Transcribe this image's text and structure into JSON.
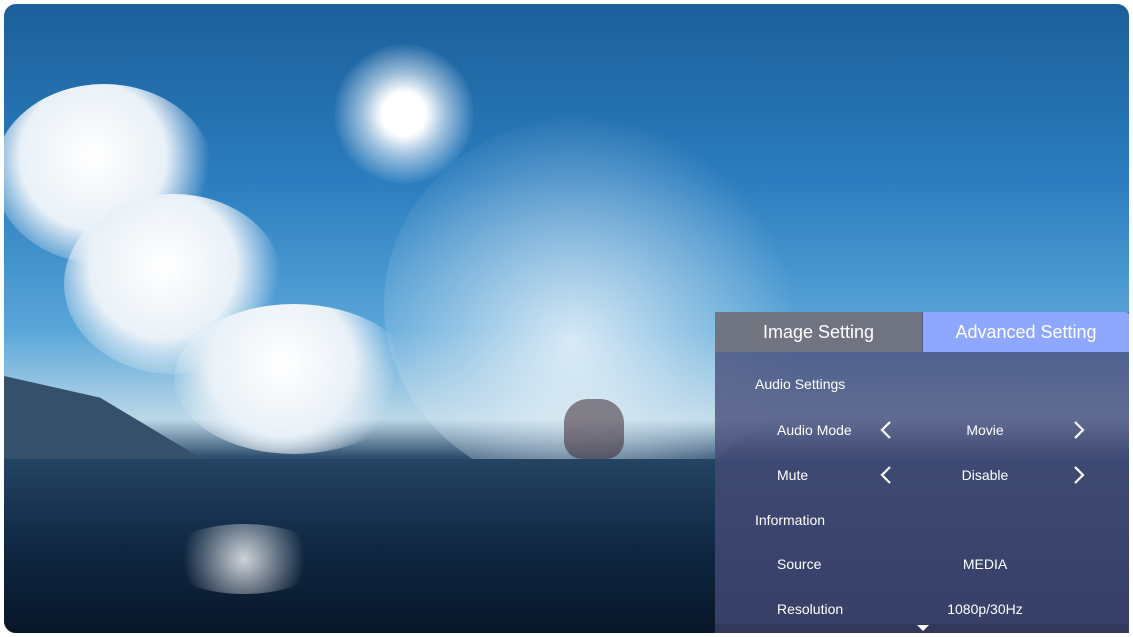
{
  "tabs": [
    {
      "label": "Image Setting",
      "active": false
    },
    {
      "label": "Advanced Setting",
      "active": true
    }
  ],
  "sections": {
    "audio": {
      "title": "Audio Settings",
      "audio_mode": {
        "label": "Audio Mode",
        "value": "Movie"
      },
      "mute": {
        "label": "Mute",
        "value": "Disable"
      }
    },
    "information": {
      "title": "Information",
      "source": {
        "label": "Source",
        "value": "MEDIA"
      },
      "resolution": {
        "label": "Resolution",
        "value": "1080p/30Hz"
      }
    }
  },
  "icons": {
    "left": "chevron-left-icon",
    "right": "chevron-right-icon",
    "more": "scroll-down-icon"
  },
  "colors": {
    "active_tab": "#8ea7ff",
    "inactive_tab": "#737680",
    "panel": "#464c78"
  }
}
